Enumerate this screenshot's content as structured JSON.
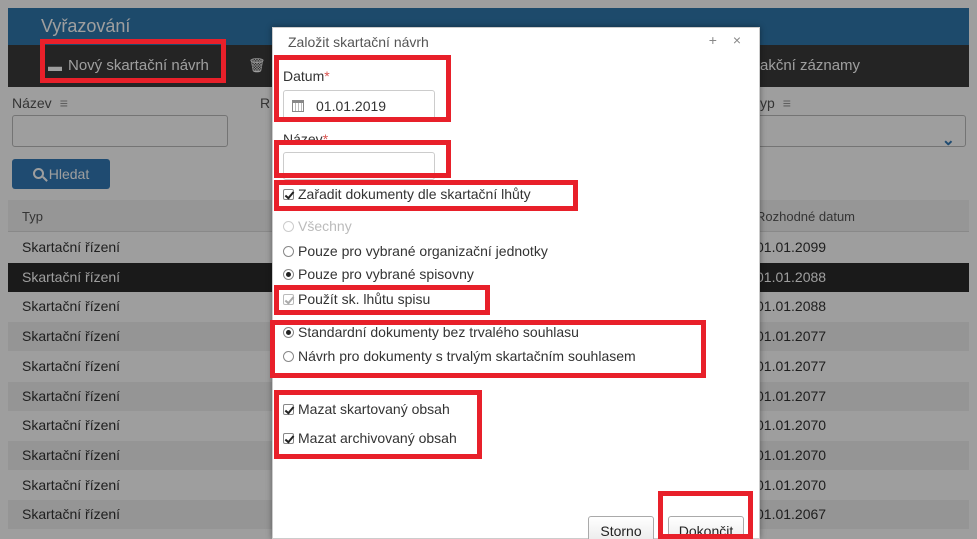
{
  "app": {
    "title": "Vyřazování",
    "toolbar": {
      "new_label": "Nový skartační návrh",
      "records_label": "akční záznamy"
    },
    "filters": {
      "name_label": "Název",
      "r_label": "R",
      "type_label": "yp",
      "search_label": "Hledat"
    },
    "table": {
      "headers": [
        "Typ",
        "Rozhodné datum"
      ],
      "rows": [
        {
          "type": "Skartační řízení",
          "date": "01.01.2099"
        },
        {
          "type": "Skartační řízení",
          "date": "01.01.2088"
        },
        {
          "type": "Skartační řízení",
          "date": "01.01.2088"
        },
        {
          "type": "Skartační řízení",
          "date": "01.01.2077"
        },
        {
          "type": "Skartační řízení",
          "date": "01.01.2077"
        },
        {
          "type": "Skartační řízení",
          "date": "01.01.2077"
        },
        {
          "type": "Skartační řízení",
          "date": "01.01.2070"
        },
        {
          "type": "Skartační řízení",
          "date": "01.01.2070"
        },
        {
          "type": "Skartační řízení",
          "date": "01.01.2070"
        },
        {
          "type": "Skartační řízení",
          "date": "01.01.2067"
        }
      ],
      "selected_row": 1
    }
  },
  "dialog": {
    "title": "Založit skartační návrh",
    "controls": "+ ×",
    "date_label": "Datum",
    "date_value": "01.01.2019",
    "name_label": "Název",
    "name_value": "",
    "required_mark": "*",
    "classify_checkbox": {
      "label": "Zařadit dokumenty dle skartační lhůty",
      "checked": true
    },
    "scope_radios": [
      {
        "label": "Všechny",
        "checked": false,
        "disabled": true
      },
      {
        "label": "Pouze pro vybrané organizační jednotky",
        "checked": false,
        "disabled": false
      },
      {
        "label": "Pouze pro vybrané spisovny",
        "checked": true,
        "disabled": false
      }
    ],
    "use_period_checkbox": {
      "label": "Použít sk. lhůtu spisu",
      "checked": true,
      "disabled": true
    },
    "consent_radios": [
      {
        "label": "Standardní dokumenty bez trvalého souhlasu",
        "checked": true
      },
      {
        "label": "Návrh pro dokumenty s trvalým skartačním souhlasem",
        "checked": false
      }
    ],
    "delete_shredded_checkbox": {
      "label": "Mazat skartovaný obsah",
      "checked": true
    },
    "delete_archived_checkbox": {
      "label": "Mazat archivovaný obsah",
      "checked": true
    },
    "cancel_label": "Storno",
    "finish_label": "Dokončit"
  },
  "colors": {
    "accent": "#337ab7",
    "titlebar": "#2f78ad",
    "toolbar": "#3a3a3a",
    "annotation": "#e8202a",
    "required": "#d9534f"
  }
}
